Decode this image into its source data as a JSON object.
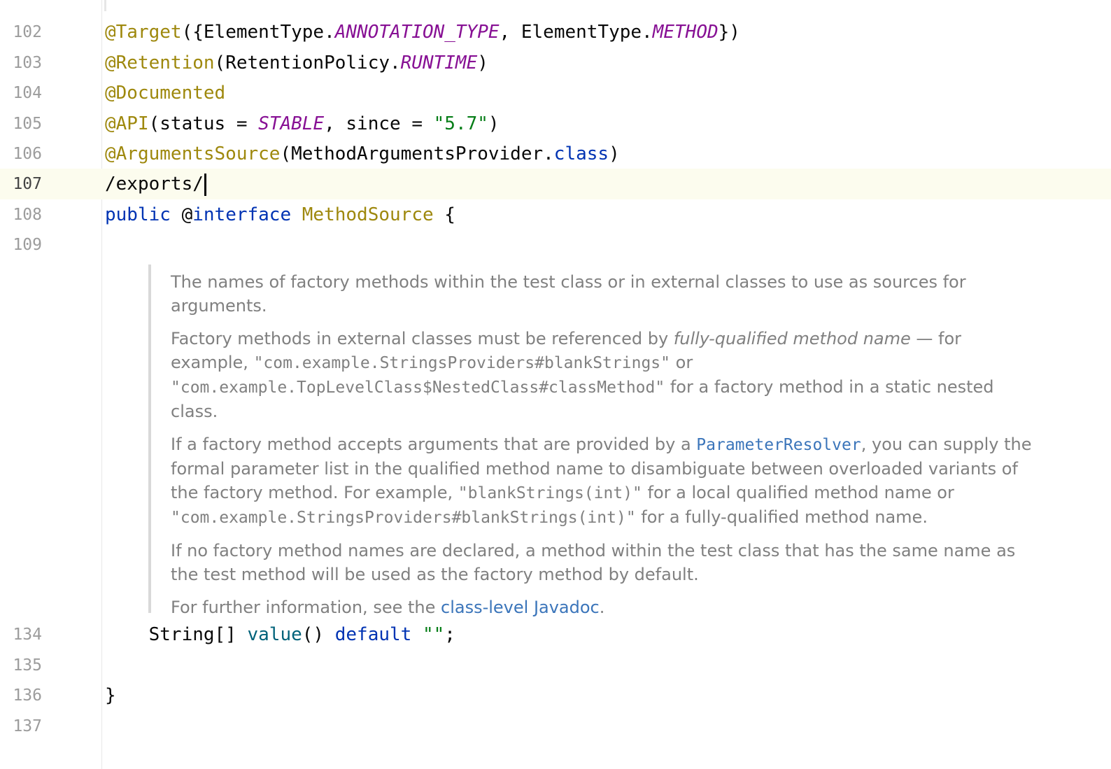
{
  "lines": [
    {
      "num": "102",
      "tokens": [
        {
          "t": "@Target",
          "c": "ann"
        },
        {
          "t": "({ElementType.",
          "c": "dim"
        },
        {
          "t": "ANNOTATION_TYPE",
          "c": "const"
        },
        {
          "t": ", ElementType.",
          "c": "dim"
        },
        {
          "t": "METHOD",
          "c": "const"
        },
        {
          "t": "})",
          "c": "dim"
        }
      ]
    },
    {
      "num": "103",
      "tokens": [
        {
          "t": "@Retention",
          "c": "ann"
        },
        {
          "t": "(RetentionPolicy.",
          "c": "dim"
        },
        {
          "t": "RUNTIME",
          "c": "const"
        },
        {
          "t": ")",
          "c": "dim"
        }
      ]
    },
    {
      "num": "104",
      "tokens": [
        {
          "t": "@Documented",
          "c": "ann"
        }
      ]
    },
    {
      "num": "105",
      "tokens": [
        {
          "t": "@API",
          "c": "ann"
        },
        {
          "t": "(status = ",
          "c": "dim"
        },
        {
          "t": "STABLE",
          "c": "const"
        },
        {
          "t": ", since = ",
          "c": "dim"
        },
        {
          "t": "\"5.7\"",
          "c": "str"
        },
        {
          "t": ")",
          "c": "dim"
        }
      ]
    },
    {
      "num": "106",
      "tokens": [
        {
          "t": "@ArgumentsSource",
          "c": "ann"
        },
        {
          "t": "(MethodArgumentsProvider.",
          "c": "dim"
        },
        {
          "t": "class",
          "c": "kw"
        },
        {
          "t": ")",
          "c": "dim"
        }
      ]
    },
    {
      "num": "107",
      "tokens": [
        {
          "t": "/exports/",
          "c": "dim"
        }
      ],
      "current": true
    },
    {
      "num": "108",
      "tokens": [
        {
          "t": "public",
          "c": "kw"
        },
        {
          "t": " @",
          "c": "dim"
        },
        {
          "t": "interface",
          "c": "kw"
        },
        {
          "t": " ",
          "c": "dim"
        },
        {
          "t": "MethodSource",
          "c": "cls"
        },
        {
          "t": " {",
          "c": "dim"
        }
      ]
    },
    {
      "num": "109",
      "tokens": []
    },
    {
      "num": "134",
      "tokens": [
        {
          "t": "    String[] ",
          "c": "dim"
        },
        {
          "t": "value",
          "c": "meth"
        },
        {
          "t": "() ",
          "c": "dim"
        },
        {
          "t": "default",
          "c": "kw"
        },
        {
          "t": " ",
          "c": "dim"
        },
        {
          "t": "\"\"",
          "c": "str"
        },
        {
          "t": ";",
          "c": "dim"
        }
      ]
    },
    {
      "num": "135",
      "tokens": []
    },
    {
      "num": "136",
      "tokens": [
        {
          "t": "}",
          "c": "dim"
        }
      ]
    },
    {
      "num": "137",
      "tokens": []
    }
  ],
  "doc": {
    "p1": "The names of factory methods within the test class or in external classes to use as sources for arguments.",
    "p2_a": "Factory methods in external classes must be referenced by ",
    "p2_em": "fully-qualified method name",
    "p2_b": " — for example, ",
    "p2_code1": "\"com.example.StringsProviders#blankStrings\"",
    "p2_c": " or ",
    "p2_code2": "\"com.example.TopLevelClass$NestedClass#classMethod\"",
    "p2_d": " for a factory method in a static nested class.",
    "p3_a": "If a factory method accepts arguments that are provided by a ",
    "p3_link": "ParameterResolver",
    "p3_b": ", you can supply the formal parameter list in the qualified method name to disambiguate between overloaded variants of the factory method. For example, ",
    "p3_code1": "\"blankStrings(int)\"",
    "p3_c": " for a local qualified method name or ",
    "p3_code2": "\"com.example.StringsProviders#blankStrings(int)\"",
    "p3_d": " for a fully-qualified method name.",
    "p4": "If no factory method names are declared, a method within the test class that has the same name as the test method will be used as the factory method by default.",
    "p5_a": "For further information, see the ",
    "p5_link": "class-level Javadoc",
    "p5_b": "."
  }
}
